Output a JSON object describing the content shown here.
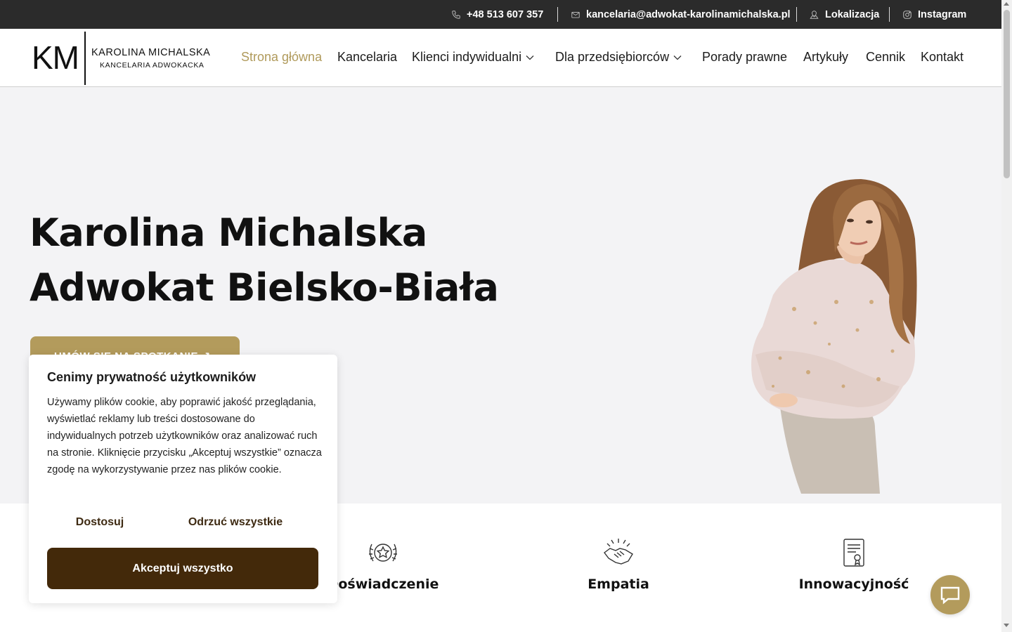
{
  "topbar": {
    "phone": "+48 513 607 357",
    "email": "kancelaria@adwokat-karolinamichalska.pl",
    "location": "Lokalizacja",
    "instagram": "Instagram"
  },
  "logo": {
    "initials": "KM",
    "name": "KAROLINA MICHALSKA",
    "subtitle": "KANCELARIA ADWOKACKA"
  },
  "nav": {
    "items": [
      {
        "label": "Strona główna",
        "active": true
      },
      {
        "label": "Kancelaria"
      },
      {
        "label": "Klienci indywidualni",
        "dropdown": true
      },
      {
        "label": "Dla przedsiębiorców",
        "dropdown": true
      },
      {
        "label": "Porady prawne"
      },
      {
        "label": "Artykuły"
      },
      {
        "label": "Cennik"
      },
      {
        "label": "Kontakt"
      }
    ]
  },
  "hero": {
    "title_line1": "Karolina Michalska",
    "title_line2": "Adwokat Bielsko-Biała",
    "cta": "UMÓW SIĘ NA SPOTKANIE ↗"
  },
  "features": [
    {
      "label": "Doświadczenie",
      "icon": "laurel-star-icon"
    },
    {
      "label": "Empatia",
      "icon": "handshake-icon"
    },
    {
      "label": "Innowacyjność",
      "icon": "certificate-icon"
    }
  ],
  "cookie": {
    "title": "Cenimy prywatność użytkowników",
    "text": "Używamy plików cookie, aby poprawić jakość przeglądania, wyświetlać reklamy lub treści dostosowane do indywidualnych potrzeb użytkowników oraz analizować ruch na stronie. Kliknięcie przycisku „Akceptuj wszystkie” oznacza zgodę na wykorzystywanie przez nas plików cookie.",
    "customize": "Dostosuj",
    "reject": "Odrzuć wszystkie",
    "accept": "Akceptuj wszystko"
  },
  "colors": {
    "accent": "#b39b5c",
    "dark_brown": "#43290a",
    "topbar": "#2b2b2b",
    "hero_bg": "#f3f3f5"
  }
}
